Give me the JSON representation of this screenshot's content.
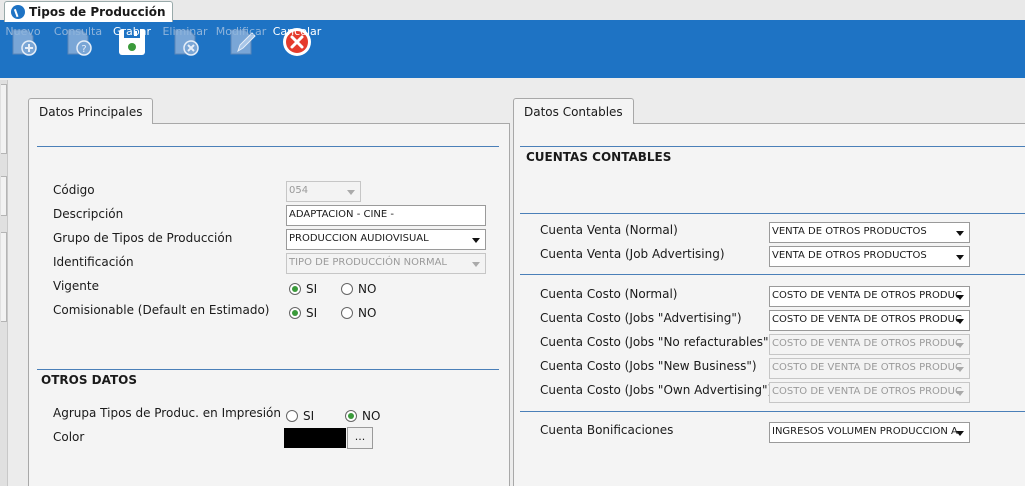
{
  "window": {
    "tab_title": "Tipos de Producción"
  },
  "toolbar": {
    "nuevo": "Nuevo",
    "consulta": "Consulta",
    "grabar": "Grabar",
    "eliminar": "Eliminar",
    "modificar": "Modificar",
    "cancelar": "Cancelar"
  },
  "principales": {
    "tab_label": "Datos Principales",
    "codigo_label": "Código",
    "codigo_value": "054",
    "descripcion_label": "Descripción",
    "descripcion_value": "ADAPTACION - CINE -",
    "grupo_label": "Grupo de Tipos de Producción",
    "grupo_value": "PRODUCCION AUDIOVISUAL",
    "identificacion_label": "Identificación",
    "identificacion_value": "TIPO DE PRODUCCIÓN NORMAL",
    "vigente_label": "Vigente",
    "comisionable_label": "Comisionable (Default en Estimado)",
    "si": "SI",
    "no": "NO",
    "vigente_selected": "SI",
    "comisionable_selected": "SI"
  },
  "otros": {
    "title": "OTROS DATOS",
    "agrupa_label": "Agrupa Tipos de Produc. en Impresión",
    "agrupa_selected": "NO",
    "color_label": "Color",
    "color_value": "#000000",
    "ellipsis": "..."
  },
  "contables": {
    "tab_label": "Datos Contables",
    "title": "CUENTAS CONTABLES",
    "venta_normal_label": "Cuenta Venta (Normal)",
    "venta_normal_value": "VENTA DE OTROS PRODUCTOS",
    "venta_job_label": "Cuenta Venta (Job Advertising)",
    "venta_job_value": "VENTA DE OTROS PRODUCTOS",
    "costo_normal_label": "Cuenta Costo (Normal)",
    "costo_normal_value": "COSTO DE VENTA DE OTROS PRODUC",
    "costo_adv_label": "Cuenta Costo (Jobs \"Advertising\")",
    "costo_adv_value": "COSTO DE VENTA DE OTROS PRODUC",
    "costo_norefact_label": "Cuenta Costo (Jobs \"No refacturables\")",
    "costo_norefact_value": "COSTO DE VENTA DE OTROS PRODUC",
    "costo_newbiz_label": "Cuenta Costo (Jobs \"New Business\")",
    "costo_newbiz_value": "COSTO DE VENTA DE OTROS PRODUC",
    "costo_own_label": "Cuenta Costo (Jobs \"Own Advertising\")",
    "costo_own_value": "COSTO DE VENTA DE OTROS PRODUC",
    "bonif_label": "Cuenta Bonificaciones",
    "bonif_value": "INGRESOS VOLUMEN PRODUCCION A"
  },
  "colors": {
    "toolbar": "#1e73c4",
    "rule": "#4a7fb8",
    "radio_on": "#3a9a3a"
  }
}
